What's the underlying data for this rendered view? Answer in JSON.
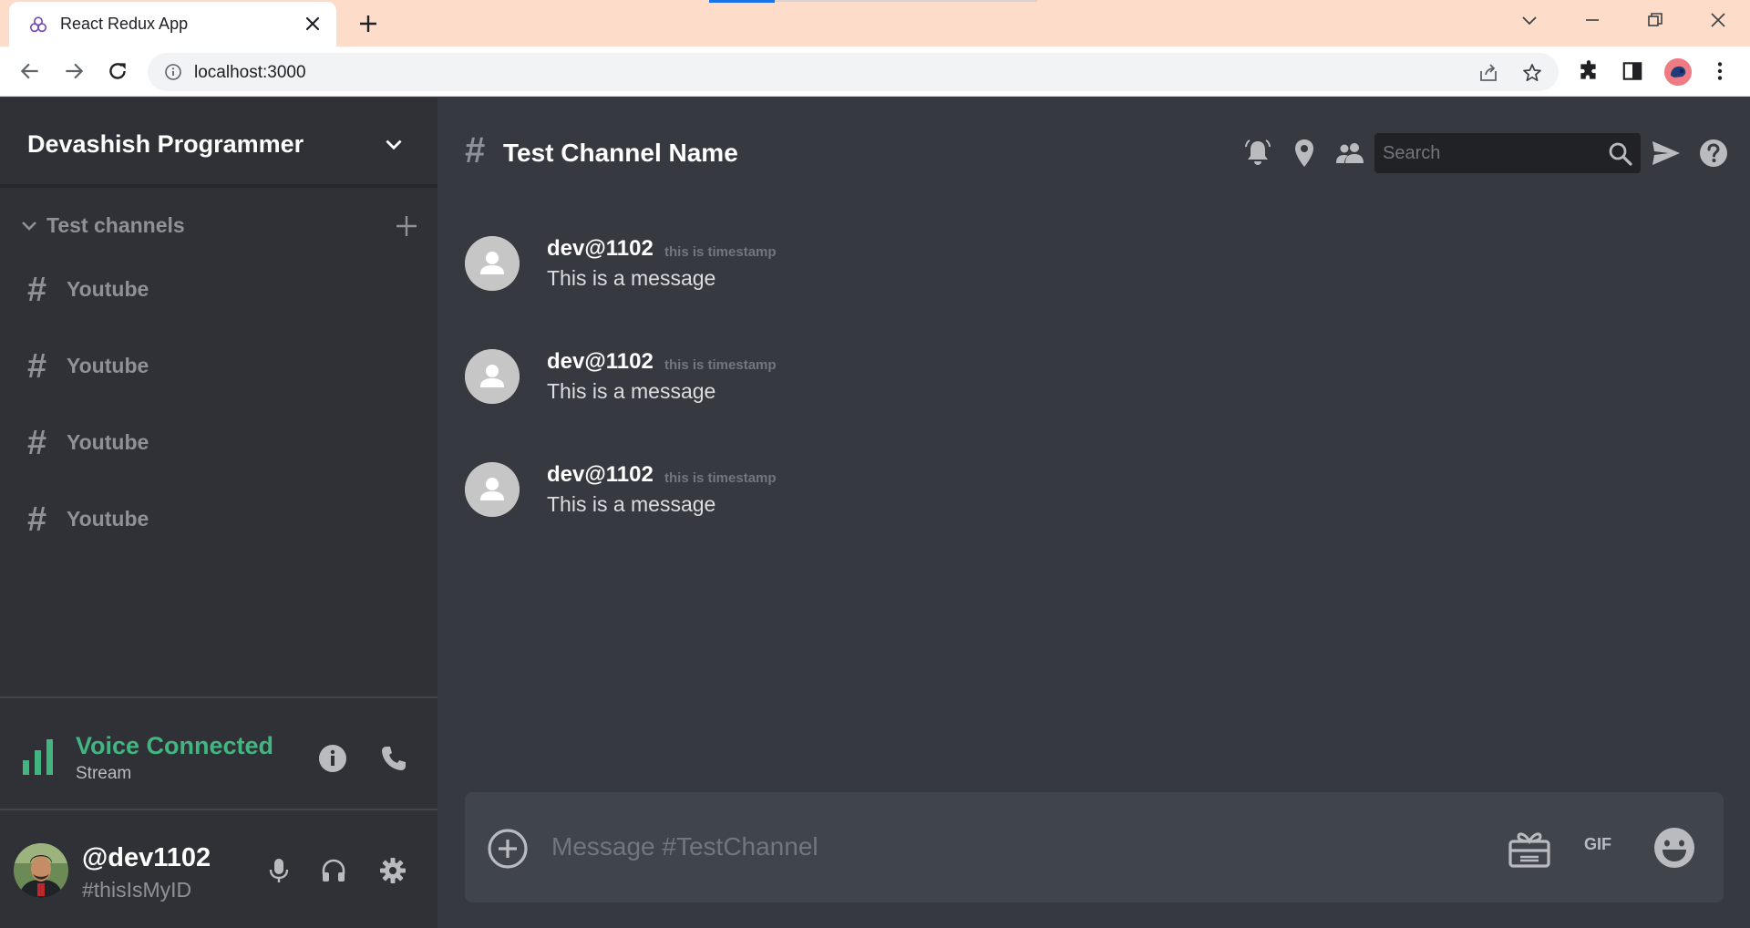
{
  "browser": {
    "tab_title": "React Redux App",
    "url": "localhost:3000"
  },
  "sidebar": {
    "server_name": "Devashish Programmer",
    "channels_header": "Test channels",
    "channels": [
      {
        "hash": "#",
        "name": "Youtube"
      },
      {
        "hash": "#",
        "name": "Youtube"
      },
      {
        "hash": "#",
        "name": "Youtube"
      },
      {
        "hash": "#",
        "name": "Youtube"
      }
    ],
    "voice": {
      "title": "Voice Connected",
      "subtitle": "Stream"
    },
    "user": {
      "name": "@dev1102",
      "id": "#thisIsMyID"
    }
  },
  "chat": {
    "hash": "#",
    "channel_name": "Test Channel Name",
    "search_placeholder": "Search",
    "messages": [
      {
        "author": "dev@1102",
        "timestamp": "this is timestamp",
        "text": "This is a message"
      },
      {
        "author": "dev@1102",
        "timestamp": "this is timestamp",
        "text": "This is a message"
      },
      {
        "author": "dev@1102",
        "timestamp": "this is timestamp",
        "text": "This is a message"
      }
    ],
    "composer_placeholder": "Message #TestChannel",
    "gif_label": "GIF"
  },
  "colors": {
    "sidebar_bg": "#2f3136",
    "chat_bg": "#36393f",
    "voice_green": "#43b581",
    "muted_text": "#8e9297",
    "tabbar_bg": "#fddcca"
  }
}
